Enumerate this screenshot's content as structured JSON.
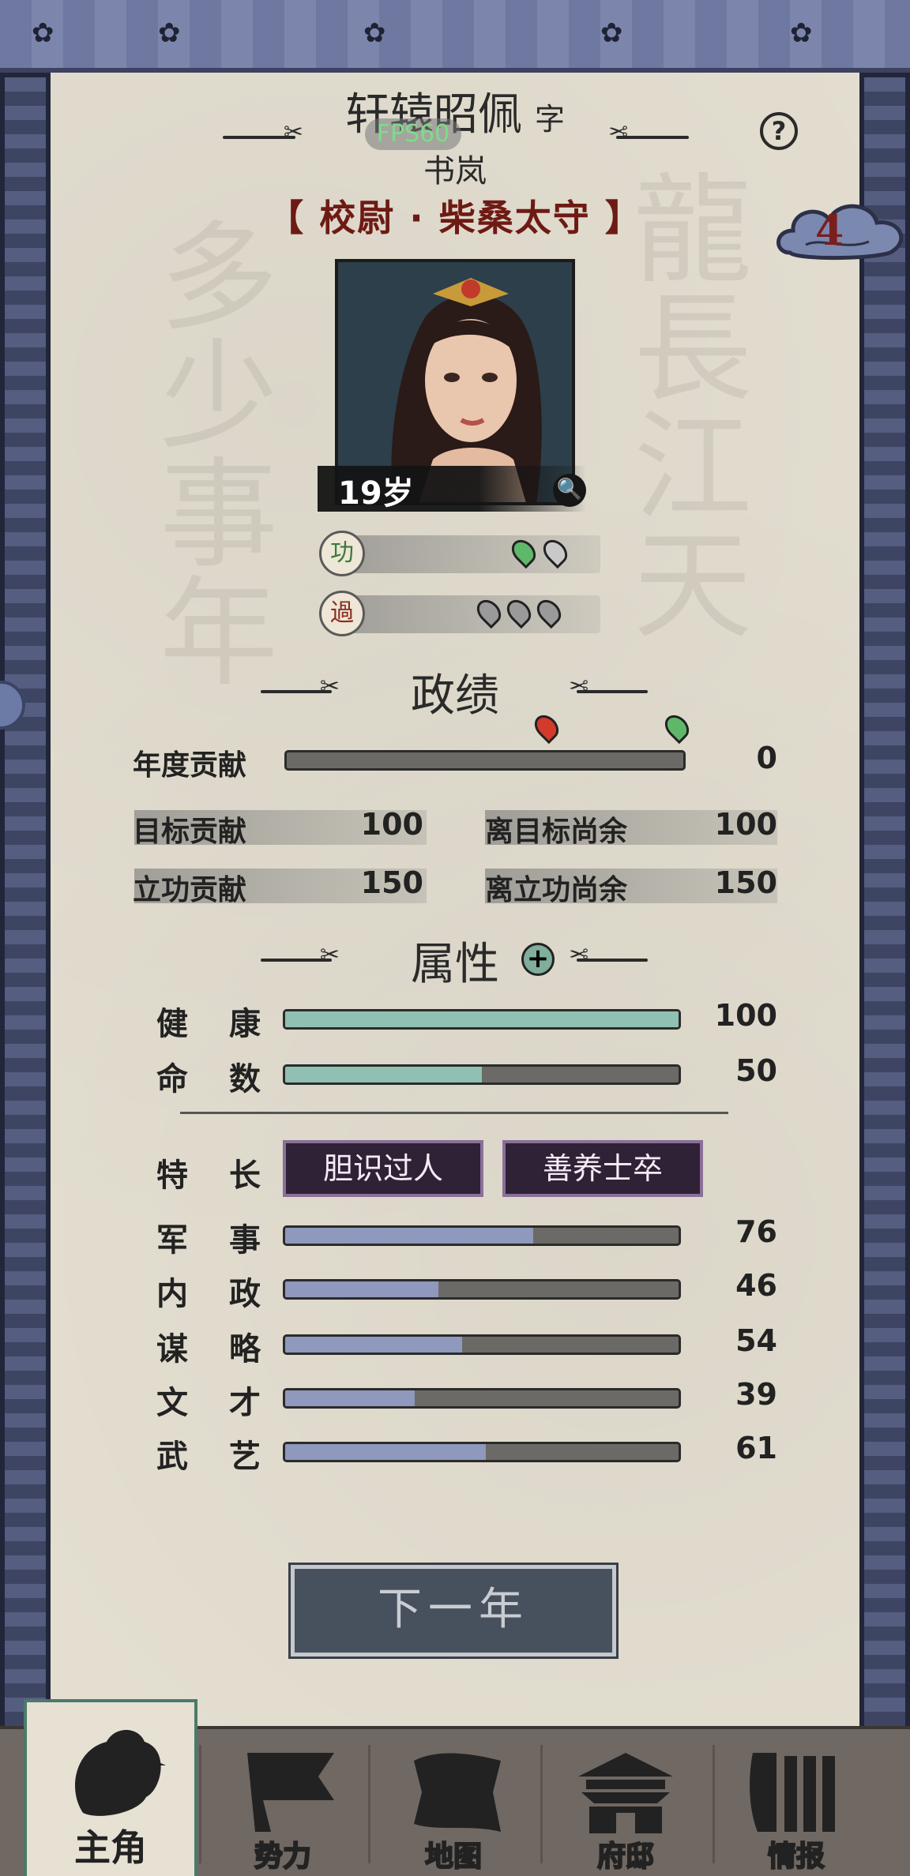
{
  "header": {
    "name": "轩辕昭佩",
    "zi_label": "字",
    "fps": "FPS60",
    "courtesy_name": "书岚",
    "rank_title": "【 校尉 · 柴桑太守 】",
    "help": "?",
    "cloud_badge": "4"
  },
  "portrait": {
    "age": "19岁"
  },
  "merit": {
    "gong": "功",
    "guo": "過",
    "gong_marks": [
      "green",
      "grey"
    ],
    "guo_marks": [
      "grey",
      "grey",
      "grey"
    ]
  },
  "performance": {
    "title": "政绩",
    "annual_label": "年度贡献",
    "annual_value": "0",
    "target_label": "目标贡献",
    "target_value": "100",
    "remaining_target_label": "离目标尚余",
    "remaining_target_value": "100",
    "merit_label": "立功贡献",
    "merit_value": "150",
    "remaining_merit_label": "离立功尚余",
    "remaining_merit_value": "150",
    "annual_fraction": 0,
    "target_marker_fraction": 0.66,
    "merit_marker_fraction": 1.0
  },
  "attributes": {
    "title": "属性",
    "plus": "+",
    "health": {
      "l1": "健",
      "l2": "康",
      "value": "100",
      "fraction": 1.0
    },
    "fate": {
      "l1": "命",
      "l2": "数",
      "value": "50",
      "fraction": 0.5
    },
    "trait_label": {
      "l1": "特",
      "l2": "长"
    },
    "traits": [
      "胆识过人",
      "善养士卒"
    ],
    "stats": [
      {
        "l1": "军",
        "l2": "事",
        "value": "76",
        "fraction": 0.63
      },
      {
        "l1": "内",
        "l2": "政",
        "value": "46",
        "fraction": 0.39
      },
      {
        "l1": "谋",
        "l2": "略",
        "value": "54",
        "fraction": 0.45
      },
      {
        "l1": "文",
        "l2": "才",
        "value": "39",
        "fraction": 0.33
      },
      {
        "l1": "武",
        "l2": "艺",
        "value": "61",
        "fraction": 0.51
      }
    ],
    "colors": {
      "health": "#8fc0b2",
      "stat": "#8f98bd",
      "track": "#6c6a66"
    }
  },
  "next_year": "下一年",
  "nav": {
    "items": [
      {
        "label": "主角",
        "icon": "general-head-icon",
        "active": true
      },
      {
        "label": "势力",
        "icon": "flag-icon",
        "active": false
      },
      {
        "label": "地图",
        "icon": "map-icon",
        "active": false
      },
      {
        "label": "府邸",
        "icon": "mansion-icon",
        "active": false
      },
      {
        "label": "情报",
        "icon": "scroll-icon",
        "active": false
      }
    ]
  }
}
